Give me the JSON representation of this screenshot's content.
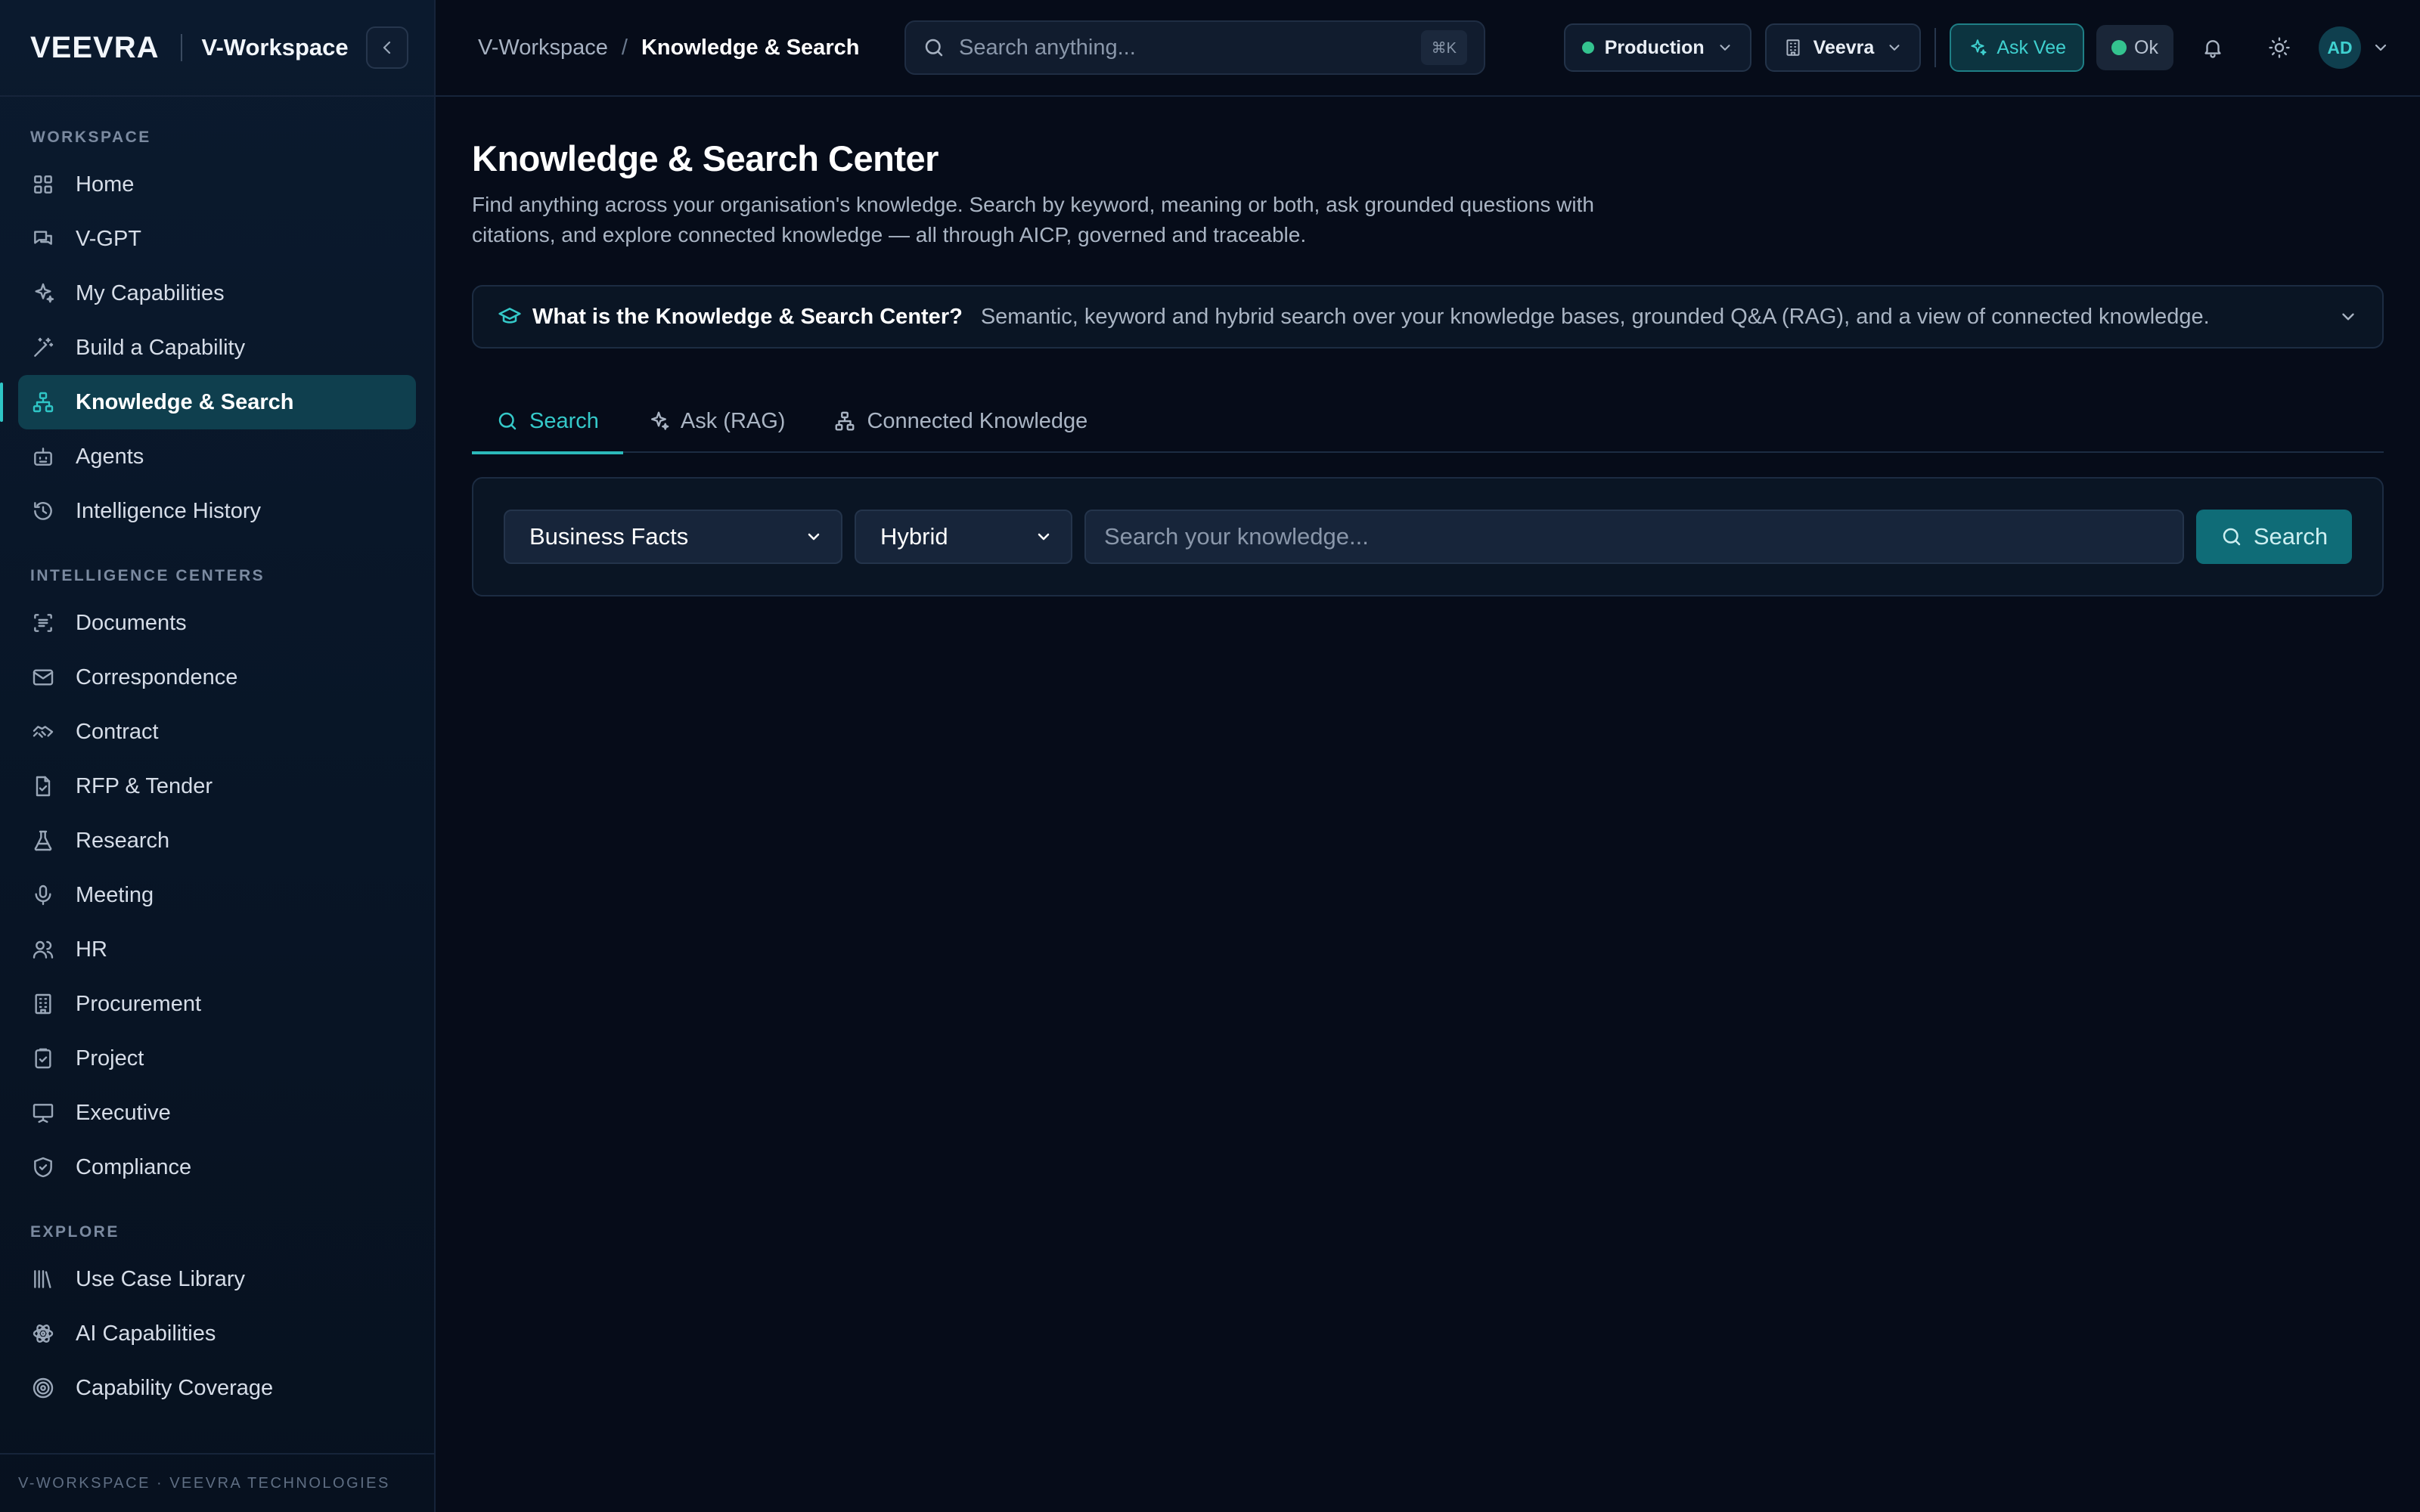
{
  "brand": {
    "logo": "VEEVRA",
    "workspace": "V-Workspace"
  },
  "sidebar": {
    "sections": [
      {
        "label": "WORKSPACE",
        "items": [
          {
            "label": "Home",
            "icon": "grid-icon"
          },
          {
            "label": "V-GPT",
            "icon": "chat-icon"
          },
          {
            "label": "My Capabilities",
            "icon": "sparkle-icon"
          },
          {
            "label": "Build a Capability",
            "icon": "wand-icon"
          },
          {
            "label": "Knowledge & Search",
            "icon": "network-icon",
            "active": true
          },
          {
            "label": "Agents",
            "icon": "bot-icon"
          },
          {
            "label": "Intelligence History",
            "icon": "history-icon"
          }
        ]
      },
      {
        "label": "INTELLIGENCE CENTERS",
        "items": [
          {
            "label": "Documents",
            "icon": "document-scan-icon"
          },
          {
            "label": "Correspondence",
            "icon": "mail-icon"
          },
          {
            "label": "Contract",
            "icon": "handshake-icon"
          },
          {
            "label": "RFP & Tender",
            "icon": "file-check-icon"
          },
          {
            "label": "Research",
            "icon": "flask-icon"
          },
          {
            "label": "Meeting",
            "icon": "mic-icon"
          },
          {
            "label": "HR",
            "icon": "users-icon"
          },
          {
            "label": "Procurement",
            "icon": "building-icon"
          },
          {
            "label": "Project",
            "icon": "clipboard-icon"
          },
          {
            "label": "Executive",
            "icon": "presentation-icon"
          },
          {
            "label": "Compliance",
            "icon": "shield-check-icon"
          }
        ]
      },
      {
        "label": "EXPLORE",
        "items": [
          {
            "label": "Use Case Library",
            "icon": "library-icon"
          },
          {
            "label": "AI Capabilities",
            "icon": "atom-icon"
          },
          {
            "label": "Capability Coverage",
            "icon": "target-icon"
          }
        ]
      }
    ],
    "footer": "V-WORKSPACE · VEEVRA TECHNOLOGIES"
  },
  "topbar": {
    "breadcrumb_parent": "V-Workspace",
    "breadcrumb_sep": "/",
    "breadcrumb_current": "Knowledge & Search",
    "search_placeholder": "Search anything...",
    "search_shortcut": "⌘K",
    "environment": "Production",
    "tenant": "Veevra",
    "ask_vee": "Ask Vee",
    "status": "Ok",
    "avatar_initials": "AD"
  },
  "page": {
    "title": "Knowledge & Search Center",
    "description": "Find anything across your organisation's knowledge. Search by keyword, meaning or both, ask grounded questions with citations, and explore connected knowledge — all through AICP, governed and traceable.",
    "info_title": "What is the Knowledge & Search Center?",
    "info_text": "Semantic, keyword and hybrid search over your knowledge bases, grounded Q&A (RAG), and a view of connected knowledge.",
    "tabs": [
      {
        "label": "Search",
        "active": true
      },
      {
        "label": "Ask (RAG)"
      },
      {
        "label": "Connected Knowledge"
      }
    ],
    "knowledge_base": "Business Facts",
    "search_mode": "Hybrid",
    "query_placeholder": "Search your knowledge...",
    "search_button": "Search"
  },
  "colors": {
    "accent": "#2fc6c6",
    "active_bg": "#0f3f4e",
    "status_ok": "#34c38f",
    "background": "#060c19"
  }
}
